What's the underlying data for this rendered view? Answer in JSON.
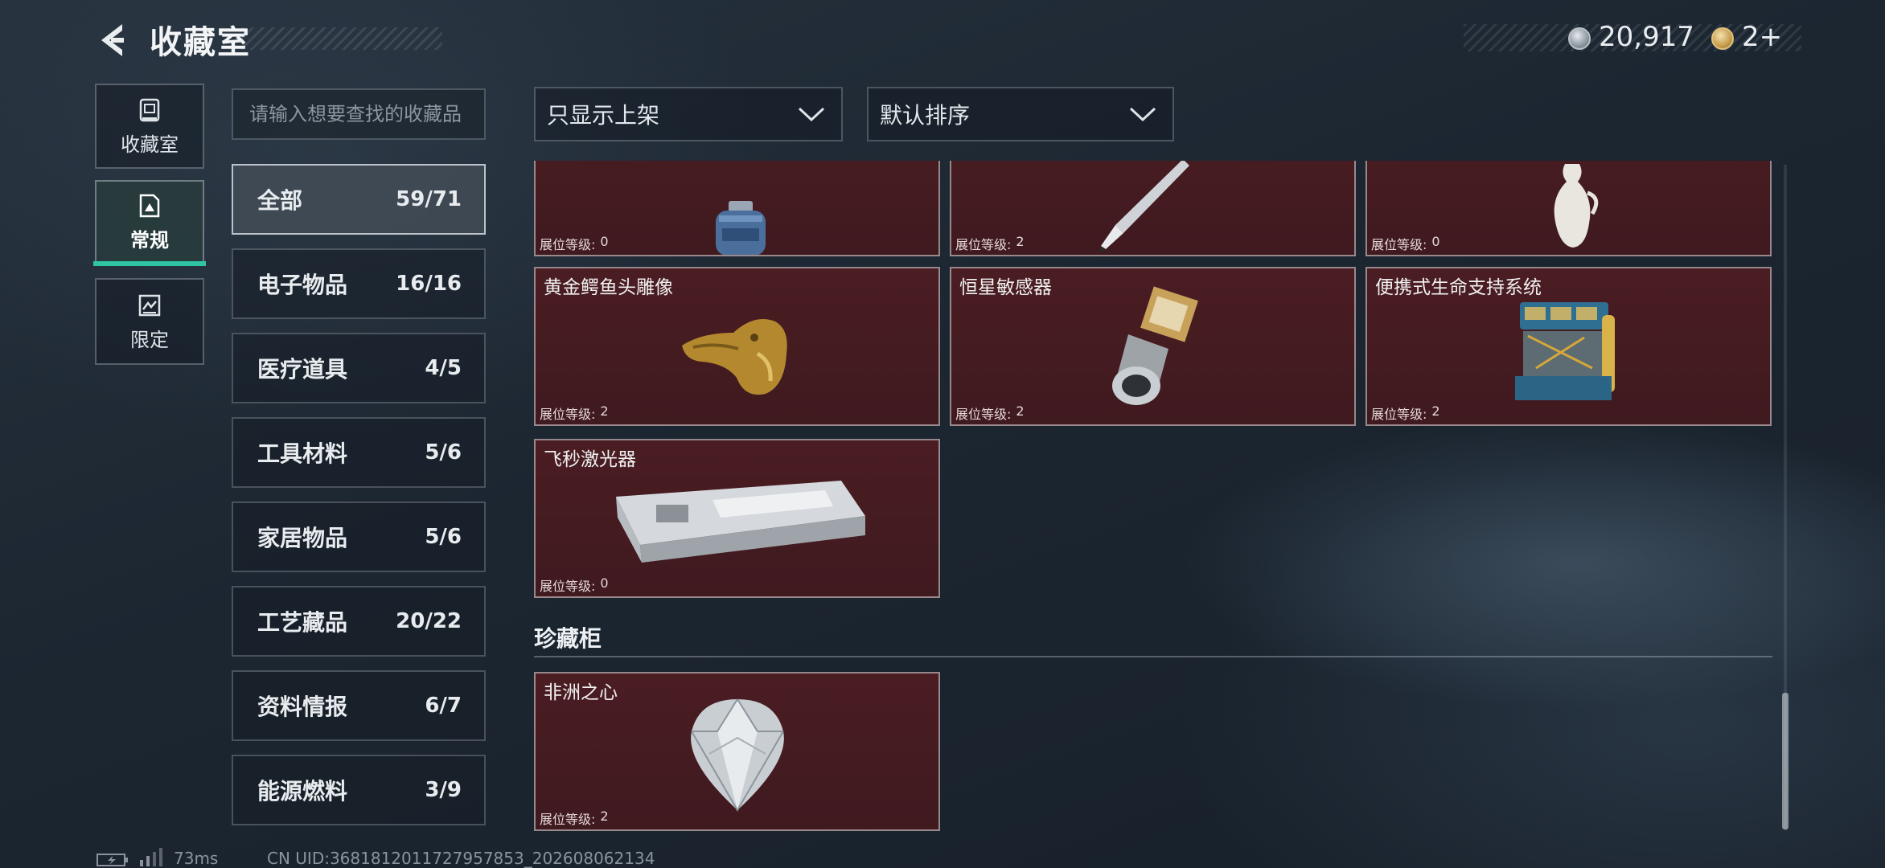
{
  "header": {
    "title": "收藏室",
    "coins": "20,917",
    "coin_icon": "silver-coin-icon",
    "tickets": "2+",
    "ticket_icon": "gold-ticket-icon"
  },
  "nav": [
    {
      "label": "收藏室",
      "icon": "vault-icon",
      "active": false
    },
    {
      "label": "常规",
      "icon": "gallery-icon",
      "active": true
    },
    {
      "label": "限定",
      "icon": "limited-icon",
      "active": false
    }
  ],
  "search": {
    "placeholder": "请输入想要查找的收藏品",
    "value": ""
  },
  "categories": [
    {
      "name": "全部",
      "count": "59/71",
      "active": true
    },
    {
      "name": "电子物品",
      "count": "16/16"
    },
    {
      "name": "医疗道具",
      "count": "4/5"
    },
    {
      "name": "工具材料",
      "count": "5/6"
    },
    {
      "name": "家居物品",
      "count": "5/6"
    },
    {
      "name": "工艺藏品",
      "count": "20/22"
    },
    {
      "name": "资料情报",
      "count": "6/7"
    },
    {
      "name": "能源燃料",
      "count": "3/9"
    }
  ],
  "filters": {
    "listing_filter": "只显示上架",
    "sort": "默认排序"
  },
  "level_label": "展位等级:",
  "items": [
    {
      "name": "",
      "level": "0",
      "art": "gas-canister-icon"
    },
    {
      "name": "",
      "level": "2",
      "art": "fountain-pen-icon"
    },
    {
      "name": "",
      "level": "0",
      "art": "porcelain-ewer-icon"
    },
    {
      "name": "黄金鳄鱼头雕像",
      "level": "2",
      "art": "gold-crocodile-head-icon"
    },
    {
      "name": "恒星敏感器",
      "level": "2",
      "art": "star-sensor-icon"
    },
    {
      "name": "便携式生命支持系统",
      "level": "2",
      "art": "life-support-icon"
    },
    {
      "name": "飞秒激光器",
      "level": "0",
      "art": "femtosecond-laser-icon"
    }
  ],
  "treasure_section": {
    "title": "珍藏柜",
    "items": [
      {
        "name": "非洲之心",
        "level": "2",
        "art": "diamond-icon"
      }
    ]
  },
  "footer": {
    "ping": "73ms",
    "uid": "CN UID:3681812011727957853_202608062134"
  }
}
